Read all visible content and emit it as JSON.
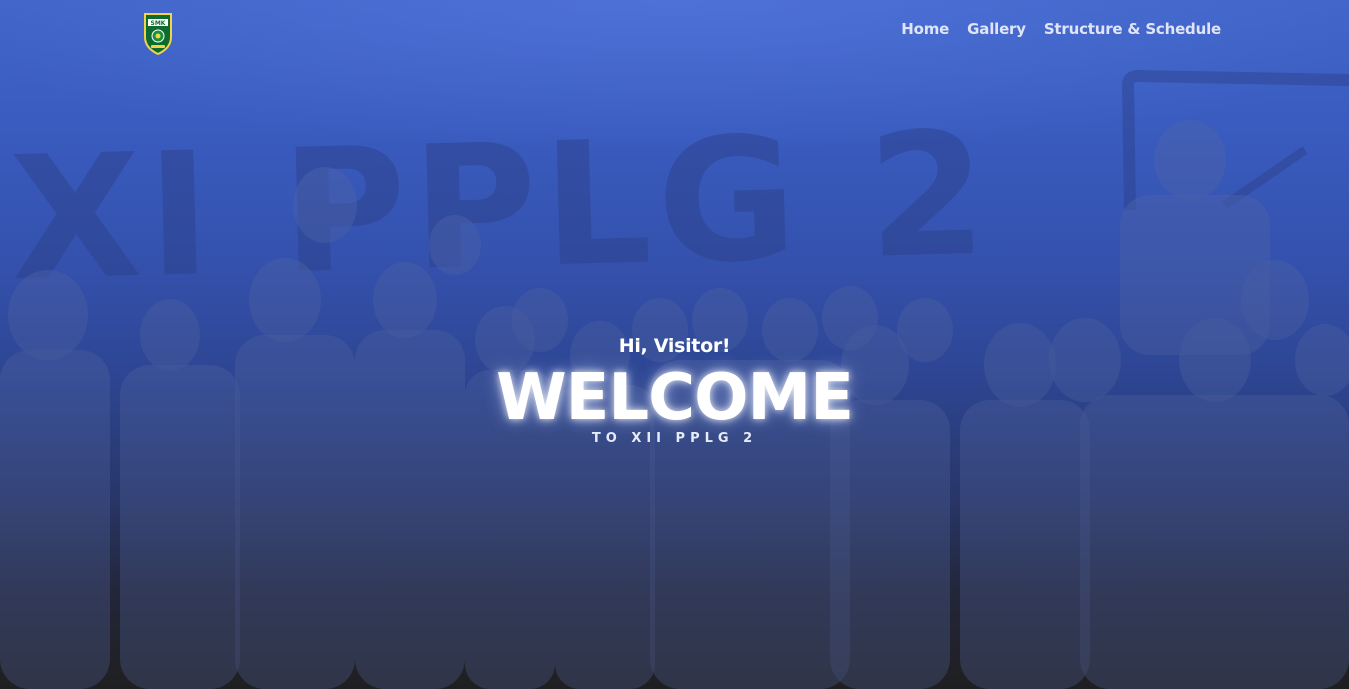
{
  "navbar": {
    "logo": {
      "icon": "school-crest-icon",
      "text": "SMK",
      "colors": {
        "shield": "#0d6b2e",
        "border": "#f2d34a",
        "accent": "#ffffff"
      }
    },
    "links": [
      {
        "label": "Home"
      },
      {
        "label": "Gallery"
      },
      {
        "label": "Structure & Schedule"
      }
    ]
  },
  "hero": {
    "greeting": "Hi, Visitor!",
    "title": "WELCOME",
    "subtitle": "TO XII PPLG 2"
  },
  "background": {
    "photo_banner_text": "XI PPLG 2",
    "colors": {
      "top": "#3f63c6",
      "middle": "#2d4592",
      "bottom": "#1f1f21",
      "text": "#ffffff"
    }
  }
}
